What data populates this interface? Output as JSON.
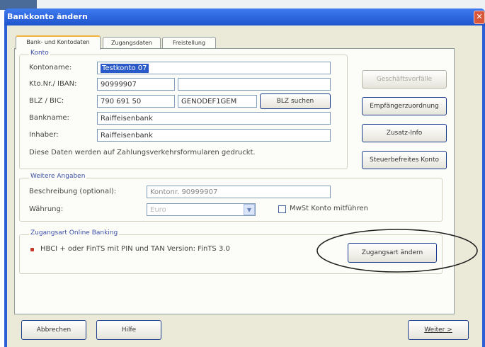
{
  "window": {
    "title": "Bankkonto ändern",
    "close_glyph": "✕"
  },
  "tabs": [
    {
      "label": "Bank- und Kontodaten",
      "active": true
    },
    {
      "label": "Zugangsdaten",
      "active": false
    },
    {
      "label": "Freistellung",
      "active": false
    }
  ],
  "konto": {
    "group_label": "Konto",
    "kontoname": {
      "label": "Kontoname:",
      "value": "Testkonto 07"
    },
    "kto_iban": {
      "label": "Kto.Nr./ IBAN:",
      "value": "90999907",
      "iban_value": ""
    },
    "blz_bic": {
      "label": "BLZ / BIC:",
      "blz_value": "790 691 50",
      "bic_value": "GENODEF1GEM",
      "search_button": "BLZ suchen"
    },
    "bankname": {
      "label": "Bankname:",
      "value": "Raiffeisenbank"
    },
    "inhaber": {
      "label": "Inhaber:",
      "value": "Raiffeisenbank"
    },
    "note": "Diese Daten werden auf Zahlungsverkehrsformularen gedruckt."
  },
  "side_buttons": {
    "geschaeftsvorfaelle": "Geschäftsvorfälle",
    "empfaengerzuordnung": "Empfängerzuordnung",
    "zusatz_info": "Zusatz-Info",
    "steuerbefreites_konto": "Steuerbefreites Konto"
  },
  "weitere": {
    "group_label": "Weitere Angaben",
    "beschreibung": {
      "label": "Beschreibung (optional):",
      "value": "Kontonr. 90999907"
    },
    "waehrung": {
      "label": "Währung:",
      "value": "Euro",
      "arrow": "▼"
    },
    "mwst": {
      "label": "MwSt Konto mitführen",
      "checked": false
    }
  },
  "zugangsart": {
    "group_label": "Zugangsart Online Banking",
    "info": "HBCI + oder FinTS mit PIN und TAN   Version: FinTS 3.0",
    "change_button": "Zugangsart ändern"
  },
  "footer": {
    "abbrechen": "Abbrechen",
    "hilfe": "Hilfe",
    "weiter": "Weiter >"
  }
}
